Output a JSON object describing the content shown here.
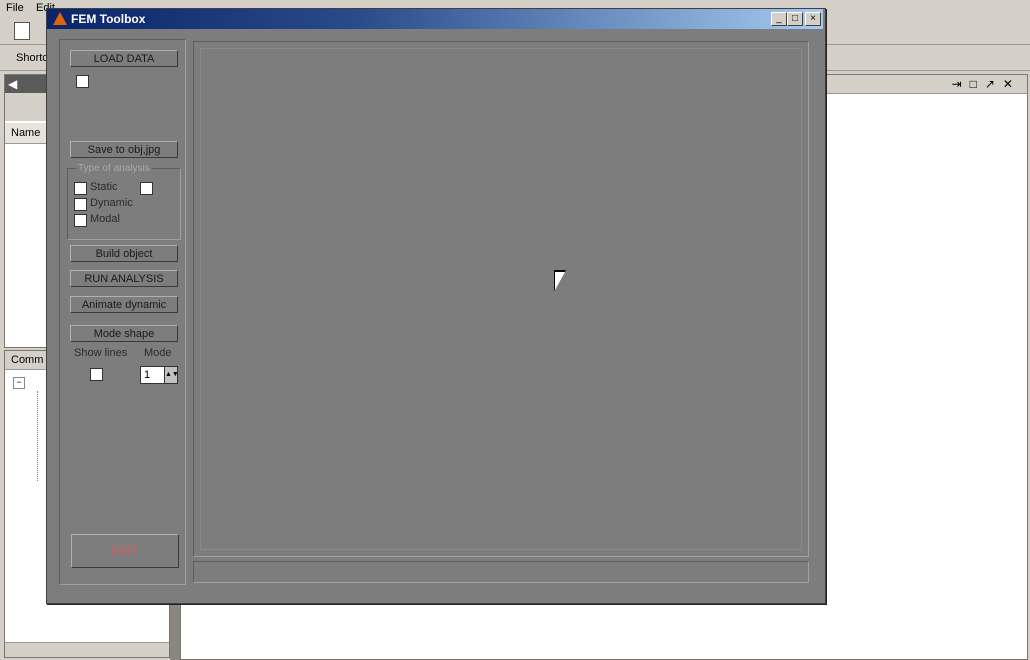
{
  "desktop": {
    "menu": [
      "File",
      "Edit"
    ],
    "shortcuts_label": "Shortc",
    "workspace_col": "Name",
    "history_title": "Comm"
  },
  "figure": {
    "title": "FEM Toolbox",
    "controls": {
      "minimize": "_",
      "maximize": "□",
      "close": "×"
    }
  },
  "panel": {
    "load_data": "LOAD DATA",
    "save": "Save to obj,jpg",
    "type_title": "Type of analysis",
    "static": "Static",
    "dynamic": "Dynamic",
    "modal": "Modal",
    "build_object": "Build object",
    "run_analysis": "RUN ANALYSIS",
    "animate_dynamic": "Animate dynamic",
    "mode_shape": "Mode shape",
    "show_lines": "Show lines",
    "mode_label": "Mode",
    "mode_value": "1",
    "exit": "EXIT"
  }
}
